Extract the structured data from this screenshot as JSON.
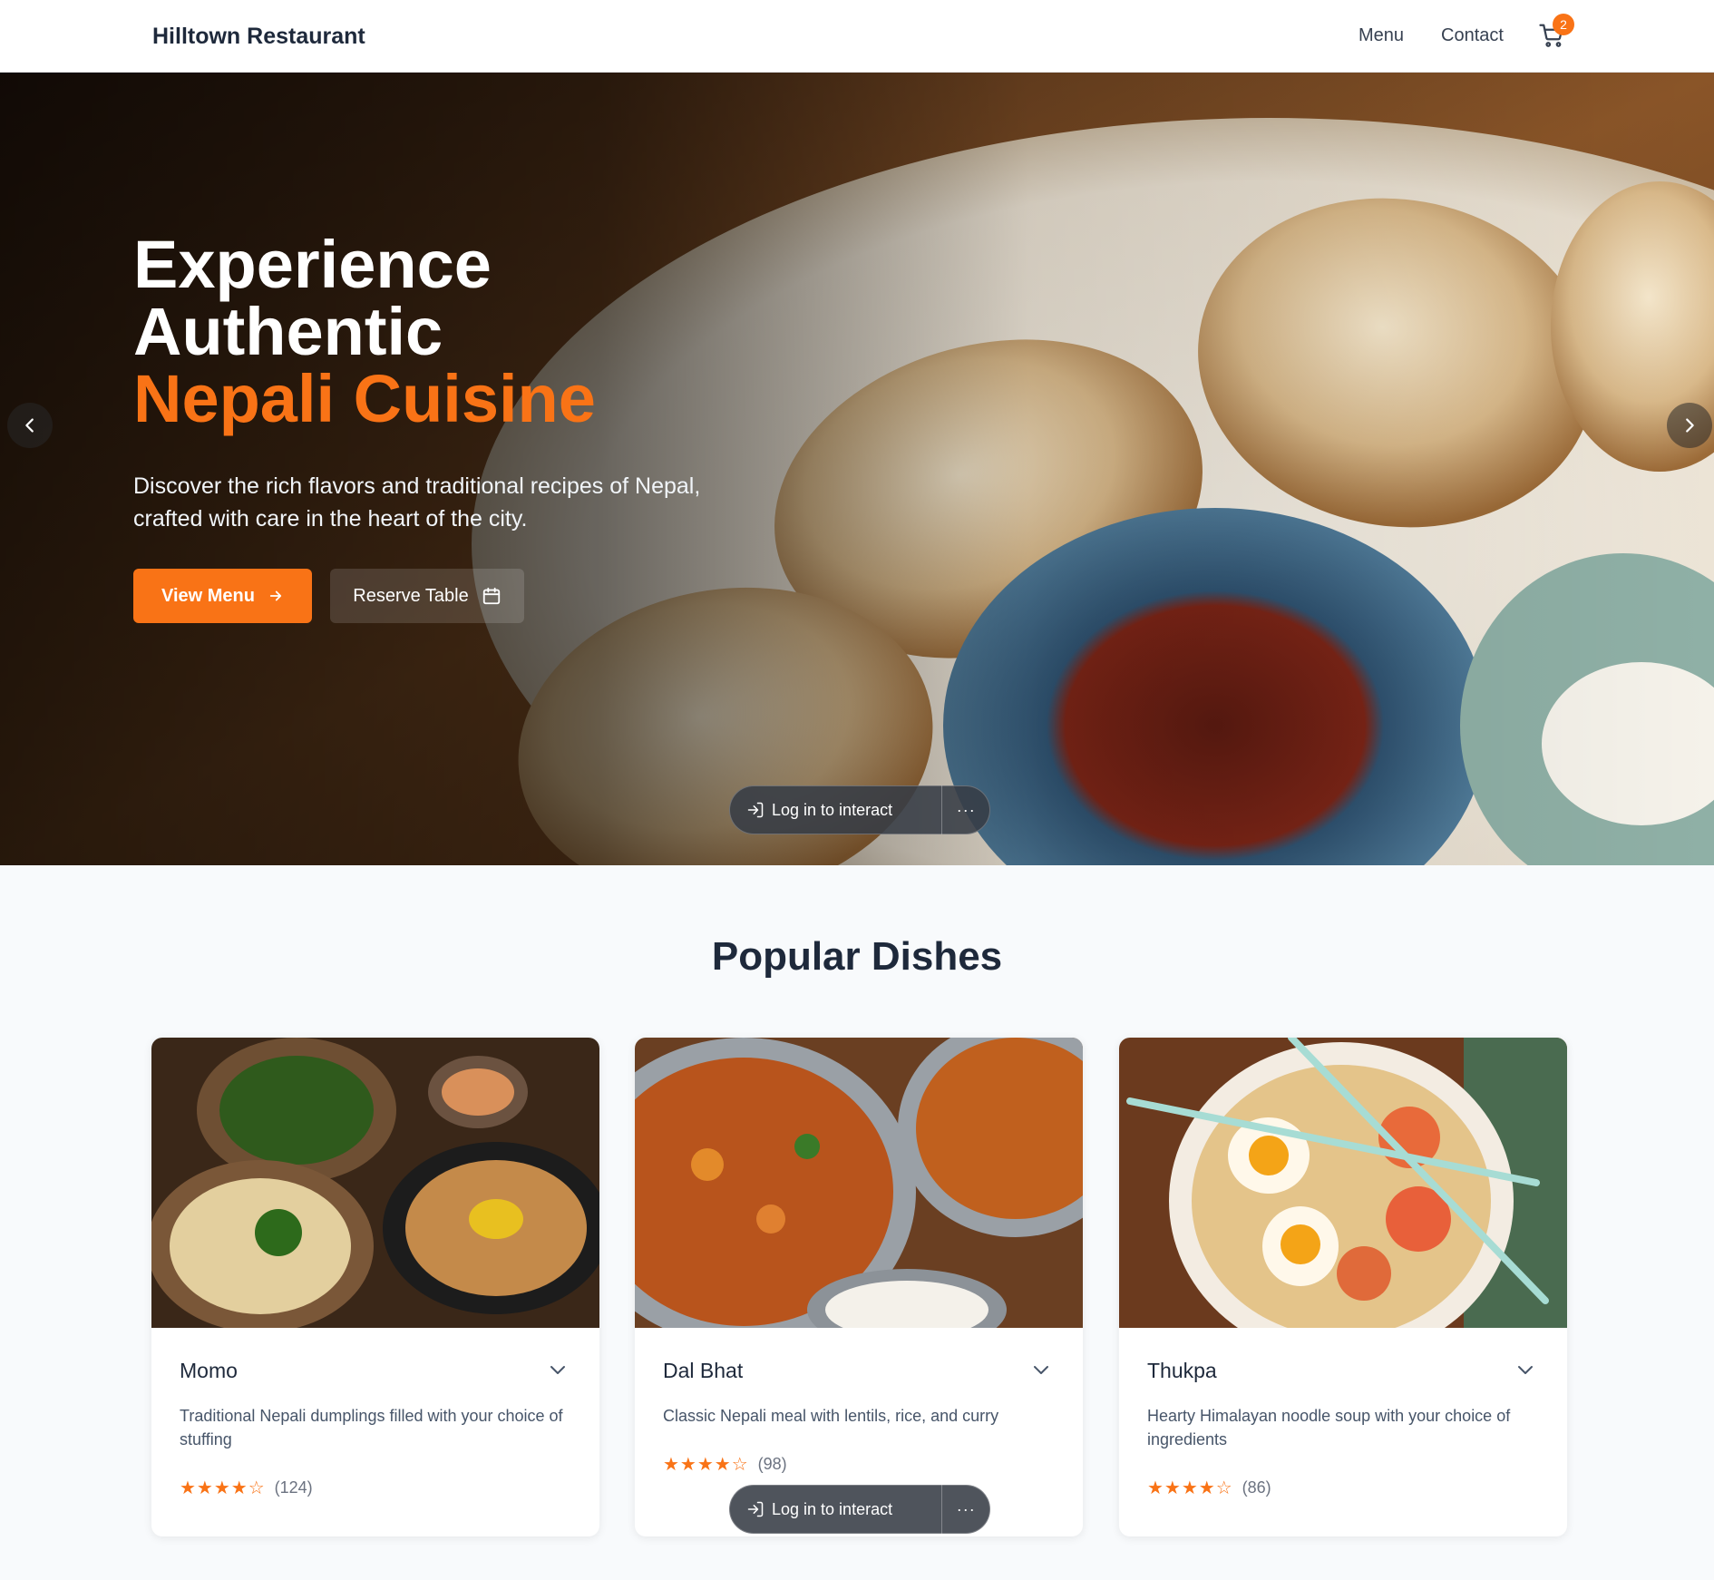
{
  "nav": {
    "brand": "Hilltown Restaurant",
    "links": [
      "Menu",
      "Contact"
    ],
    "cart_count": "2"
  },
  "hero": {
    "title_line1": "Experience",
    "title_line2": "Authentic",
    "title_accent": "Nepali Cuisine",
    "subtitle": "Discover the rich flavors and traditional recipes of Nepal, crafted with care in the heart of the city.",
    "primary_button": "View Menu",
    "secondary_button": "Reserve Table"
  },
  "overlay": {
    "login_label": "Log in to interact",
    "more": "···"
  },
  "popular": {
    "title": "Popular Dishes",
    "dishes": [
      {
        "name": "Momo",
        "description": "Traditional Nepali dumplings filled with your choice of stuffing",
        "stars": "★★★★☆",
        "rating": 4,
        "count": "(124)"
      },
      {
        "name": "Dal Bhat",
        "description": "Classic Nepali meal with lentils, rice, and curry",
        "stars": "★★★★☆",
        "rating": 4,
        "count": "(98)"
      },
      {
        "name": "Thukpa",
        "description": "Hearty Himalayan noodle soup with your choice of ingredients",
        "stars": "★★★★☆",
        "rating": 4,
        "count": "(86)"
      }
    ]
  },
  "colors": {
    "accent": "#f97316",
    "text_dark": "#1e293b",
    "page_bg": "#f8fafc"
  }
}
